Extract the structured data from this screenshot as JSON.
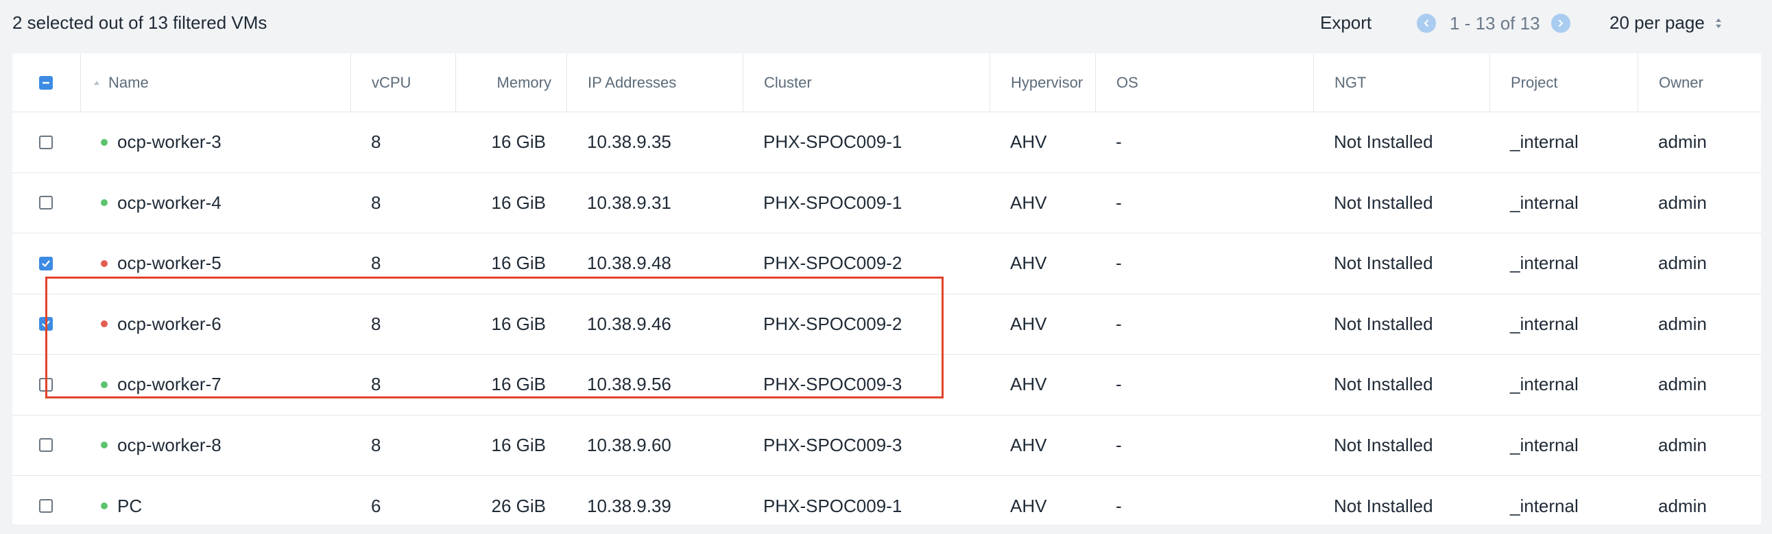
{
  "summary": {
    "text": "2 selected out of 13 filtered VMs"
  },
  "toolbar": {
    "export_label": "Export",
    "pagination_range": "1 - 13 of 13",
    "per_page_label": "20 per page"
  },
  "colors": {
    "accent": "#3d8be2",
    "status_on": "#5cc36e",
    "status_off": "#e45e52",
    "highlight": "#e2432a"
  },
  "table": {
    "columns": {
      "name": "Name",
      "vcpu": "vCPU",
      "memory": "Memory",
      "ip": "IP Addresses",
      "cluster": "Cluster",
      "hypervisor": "Hypervisor",
      "os": "OS",
      "ngt": "NGT",
      "project": "Project",
      "owner": "Owner"
    },
    "rows": [
      {
        "checked": false,
        "status": "on",
        "name": "ocp-worker-3",
        "vcpu": "8",
        "memory": "16 GiB",
        "ip": "10.38.9.35",
        "cluster": "PHX-SPOC009-1",
        "hypervisor": "AHV",
        "os": "-",
        "ngt": "Not Installed",
        "project": "_internal",
        "owner": "admin"
      },
      {
        "checked": false,
        "status": "on",
        "name": "ocp-worker-4",
        "vcpu": "8",
        "memory": "16 GiB",
        "ip": "10.38.9.31",
        "cluster": "PHX-SPOC009-1",
        "hypervisor": "AHV",
        "os": "-",
        "ngt": "Not Installed",
        "project": "_internal",
        "owner": "admin"
      },
      {
        "checked": true,
        "status": "off",
        "name": "ocp-worker-5",
        "vcpu": "8",
        "memory": "16 GiB",
        "ip": "10.38.9.48",
        "cluster": "PHX-SPOC009-2",
        "hypervisor": "AHV",
        "os": "-",
        "ngt": "Not Installed",
        "project": "_internal",
        "owner": "admin"
      },
      {
        "checked": true,
        "status": "off",
        "name": "ocp-worker-6",
        "vcpu": "8",
        "memory": "16 GiB",
        "ip": "10.38.9.46",
        "cluster": "PHX-SPOC009-2",
        "hypervisor": "AHV",
        "os": "-",
        "ngt": "Not Installed",
        "project": "_internal",
        "owner": "admin"
      },
      {
        "checked": false,
        "status": "on",
        "name": "ocp-worker-7",
        "vcpu": "8",
        "memory": "16 GiB",
        "ip": "10.38.9.56",
        "cluster": "PHX-SPOC009-3",
        "hypervisor": "AHV",
        "os": "-",
        "ngt": "Not Installed",
        "project": "_internal",
        "owner": "admin"
      },
      {
        "checked": false,
        "status": "on",
        "name": "ocp-worker-8",
        "vcpu": "8",
        "memory": "16 GiB",
        "ip": "10.38.9.60",
        "cluster": "PHX-SPOC009-3",
        "hypervisor": "AHV",
        "os": "-",
        "ngt": "Not Installed",
        "project": "_internal",
        "owner": "admin"
      },
      {
        "checked": false,
        "status": "on",
        "name": "PC",
        "vcpu": "6",
        "memory": "26 GiB",
        "ip": "10.38.9.39",
        "cluster": "PHX-SPOC009-1",
        "hypervisor": "AHV",
        "os": "-",
        "ngt": "Not Installed",
        "project": "_internal",
        "owner": "admin"
      }
    ]
  }
}
